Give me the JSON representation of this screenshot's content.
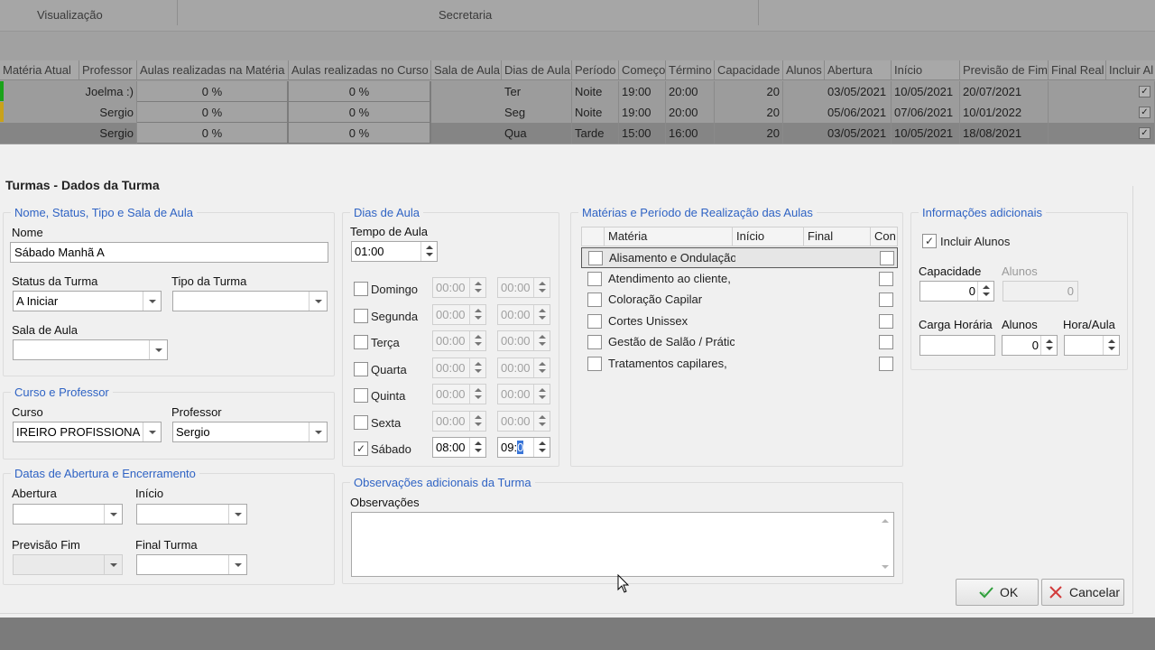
{
  "background": {
    "ribbon_groups": [
      "Visualização",
      "Secretaria"
    ],
    "columns": [
      "Matéria Atual",
      "Professor",
      "Aulas realizadas na Matéria",
      "Aulas realizadas no Curso",
      "Sala de Aula",
      "Dias de Aula",
      "Período",
      "Começo",
      "Término",
      "Capacidade",
      "Alunos",
      "Abertura",
      "Início",
      "Previsão de Fim",
      "Final Real",
      "Incluir Al"
    ],
    "rows": [
      {
        "professor": "Joelma :)",
        "aulas_materia": "0 %",
        "aulas_curso": "0 %",
        "dia": "Ter",
        "periodo": "Noite",
        "comeco": "19:00",
        "termino": "20:00",
        "capacidade": "20",
        "abertura": "03/05/2021",
        "inicio": "10/05/2021",
        "previsao": "20/07/2021",
        "marker_color": "#1aa31a",
        "selected": false
      },
      {
        "professor": "Sergio",
        "aulas_materia": "0 %",
        "aulas_curso": "0 %",
        "dia": "Seg",
        "periodo": "Noite",
        "comeco": "19:00",
        "termino": "20:00",
        "capacidade": "20",
        "abertura": "05/06/2021",
        "inicio": "07/06/2021",
        "previsao": "10/01/2022",
        "marker_color": "#c9a21a",
        "selected": false
      },
      {
        "professor": "Sergio",
        "aulas_materia": "0 %",
        "aulas_curso": "0 %",
        "dia": "Qua",
        "periodo": "Tarde",
        "comeco": "15:00",
        "termino": "16:00",
        "capacidade": "20",
        "abertura": "03/05/2021",
        "inicio": "10/05/2021",
        "previsao": "18/08/2021",
        "marker_color": "",
        "selected": true
      }
    ]
  },
  "dialog": {
    "title": "Turmas - Dados da Turma",
    "nome_group": {
      "title": "Nome, Status, Tipo e Sala de Aula",
      "nome_label": "Nome",
      "nome_value": "Sábado Manhã A",
      "status_label": "Status da Turma",
      "status_value": "A Iniciar",
      "tipo_label": "Tipo da Turma",
      "tipo_value": "",
      "sala_label": "Sala de Aula",
      "sala_value": ""
    },
    "curso_group": {
      "title": "Curso e Professor",
      "curso_label": "Curso",
      "curso_value": "IREIRO PROFISSIONAL",
      "professor_label": "Professor",
      "professor_value": "Sergio"
    },
    "datas_group": {
      "title": "Datas de Abertura e Encerramento",
      "abertura_label": "Abertura",
      "inicio_label": "Início",
      "previsao_label": "Previsão Fim",
      "final_label": "Final Turma"
    },
    "dias_group": {
      "title": "Dias de Aula",
      "tempo_label": "Tempo de Aula",
      "tempo_value": "01:00",
      "days": [
        {
          "name": "Domingo",
          "checked": false,
          "start": "00:00",
          "end": "00:00"
        },
        {
          "name": "Segunda",
          "checked": false,
          "start": "00:00",
          "end": "00:00"
        },
        {
          "name": "Terça",
          "checked": false,
          "start": "00:00",
          "end": "00:00"
        },
        {
          "name": "Quarta",
          "checked": false,
          "start": "00:00",
          "end": "00:00"
        },
        {
          "name": "Quinta",
          "checked": false,
          "start": "00:00",
          "end": "00:00"
        },
        {
          "name": "Sexta",
          "checked": false,
          "start": "00:00",
          "end": "00:00"
        },
        {
          "name": "Sábado",
          "checked": true,
          "start": "08:00",
          "end_a": "09:",
          "end_b": "0"
        }
      ]
    },
    "materias_group": {
      "title": "Matérias e Período de Realização das Aulas",
      "columns": [
        "Matéria",
        "Início",
        "Final",
        "Con"
      ],
      "items": [
        "Alisamento e Ondulação",
        "Atendimento ao cliente,",
        "Coloração Capilar",
        "Cortes Unissex",
        "Gestão de Salão / Prátic",
        "Tratamentos capilares,"
      ]
    },
    "obs_group": {
      "title": "Observações adicionais da Turma",
      "obs_label": "Observações",
      "obs_value": ""
    },
    "info_group": {
      "title": "Informações adicionais",
      "incluir_label": "Incluir Alunos",
      "capacidade_label": "Capacidade",
      "capacidade_value": "0",
      "alunos_label": "Alunos",
      "alunos_value": "0",
      "carga_label": "Carga Horária",
      "carga_value": "",
      "alunos2_label": "Alunos",
      "alunos2_value": "0",
      "hora_label": "Hora/Aula",
      "hora_value": ""
    },
    "ok_label": "OK",
    "cancel_label": "Cancelar"
  }
}
